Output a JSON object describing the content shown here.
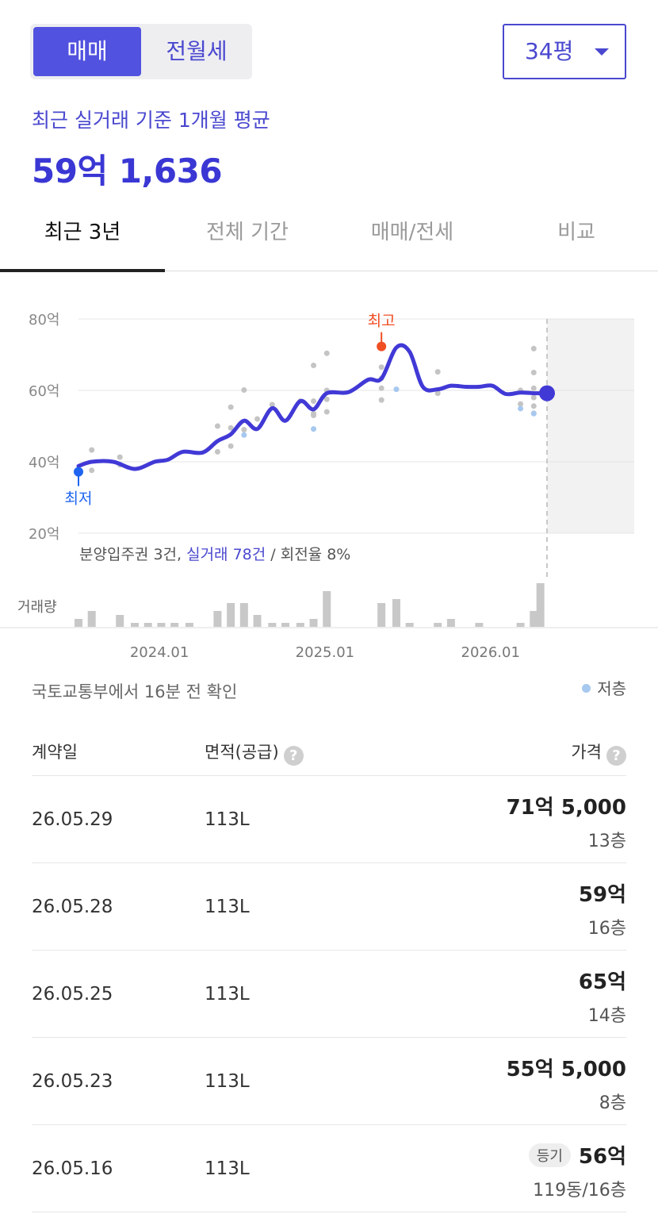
{
  "trade_tabs": {
    "sale": "매매",
    "rent": "전월세"
  },
  "size_selector": {
    "value": "34평"
  },
  "summary": {
    "caption": "최근 실거래 기준 1개월 평균",
    "value": "59억 1,636"
  },
  "period_tabs": [
    "최근 3년",
    "전체 기간",
    "매매/전세",
    "비교"
  ],
  "chart_data": {
    "type": "line",
    "y_axis": {
      "ticks": [
        "80억",
        "60억",
        "40억",
        "20억"
      ],
      "unit": "억",
      "range": [
        20,
        80
      ]
    },
    "x_axis": {
      "ticks": [
        "2024.01",
        "2025.01",
        "2026.01"
      ]
    },
    "volume_label": "거래량",
    "markers": {
      "high": "최고",
      "low": "최저"
    },
    "stats": {
      "presale": "분양입주권 3건, ",
      "actual": "실거래 78건",
      "turnover": " / 회전율 8%"
    },
    "series": [
      {
        "x": [
          2023.54,
          2023.62,
          2023.75,
          2023.88,
          2024.0,
          2024.08,
          2024.17,
          2024.29,
          2024.38,
          2024.46,
          2024.54,
          2024.62,
          2024.71,
          2024.79,
          2024.88,
          2024.96,
          2025.04,
          2025.17,
          2025.29,
          2025.37,
          2025.46,
          2025.54,
          2025.62,
          2025.71,
          2025.79,
          2025.88,
          2025.96,
          2026.04,
          2026.12,
          2026.21,
          2026.29,
          2026.37
        ],
        "y": [
          38.8,
          40,
          40,
          38,
          40,
          40.6,
          42.8,
          42.6,
          45.8,
          47.7,
          51.5,
          49.2,
          55,
          51.5,
          57,
          54.7,
          59.2,
          59.5,
          63,
          63.3,
          72,
          70.8,
          61,
          60.3,
          61.3,
          61,
          61,
          61.3,
          59,
          59.4,
          59.2,
          59.2
        ]
      }
    ],
    "transactions": [
      [
        2023.62,
        43.3
      ],
      [
        2023.62,
        37.6
      ],
      [
        2023.79,
        41.3
      ],
      [
        2023.79,
        39.2
      ],
      [
        2024.38,
        50
      ],
      [
        2024.38,
        42.8
      ],
      [
        2024.46,
        55.3
      ],
      [
        2024.46,
        49.5
      ],
      [
        2024.46,
        44.4
      ],
      [
        2024.54,
        60.1
      ],
      [
        2024.54,
        49
      ],
      [
        2024.62,
        52
      ],
      [
        2024.71,
        56
      ],
      [
        2024.88,
        57
      ],
      [
        2024.96,
        67
      ],
      [
        2024.96,
        57
      ],
      [
        2024.96,
        53.5
      ],
      [
        2024.96,
        53
      ],
      [
        2025.04,
        70.4
      ],
      [
        2025.04,
        57.5
      ],
      [
        2025.04,
        54
      ],
      [
        2025.04,
        60
      ],
      [
        2025.37,
        66.5
      ],
      [
        2025.37,
        63.4
      ],
      [
        2025.37,
        60.6
      ],
      [
        2025.37,
        57.3
      ],
      [
        2025.71,
        65.2
      ],
      [
        2025.71,
        59.2
      ],
      [
        2026.21,
        60
      ],
      [
        2026.21,
        56.2
      ],
      [
        2026.29,
        71.7
      ],
      [
        2026.29,
        65
      ],
      [
        2026.29,
        60.6
      ],
      [
        2026.29,
        58
      ],
      [
        2026.29,
        55.6
      ],
      [
        2026.29,
        53.6
      ]
    ],
    "low_floor_transactions": [
      [
        2024.54,
        47.5
      ],
      [
        2024.96,
        49.2
      ],
      [
        2025.46,
        60.3
      ],
      [
        2026.21,
        54.9
      ],
      [
        2026.29,
        53.5
      ]
    ],
    "high_point": [
      2025.37,
      72.3
    ],
    "low_point": [
      2023.54,
      37.2
    ],
    "last_point": [
      2026.37,
      59.2
    ],
    "forecast_region_start": 2026.37,
    "volume": {
      "x": [
        2023.54,
        2023.62,
        2023.79,
        2023.88,
        2023.96,
        2024.04,
        2024.12,
        2024.21,
        2024.38,
        2024.46,
        2024.54,
        2024.62,
        2024.71,
        2024.79,
        2024.88,
        2024.96,
        2025.04,
        2025.37,
        2025.46,
        2025.54,
        2025.71,
        2025.79,
        2025.96,
        2026.21,
        2026.29
      ],
      "y": [
        2,
        4,
        3,
        1,
        1,
        1,
        1,
        1,
        4,
        6,
        6,
        3,
        1,
        1,
        1,
        2,
        9,
        6,
        7,
        1,
        1,
        2,
        1,
        1,
        4,
        11
      ]
    }
  },
  "source_note": "국토교통부에서 16분 전 확인",
  "legend": {
    "low_floor": "저층"
  },
  "table": {
    "headers": {
      "date": "계약일",
      "area": "면적(공급)",
      "price": "가격"
    },
    "rows": [
      {
        "date": "26.05.29",
        "area": "113L",
        "price": "71억 5,000",
        "floor": "13층",
        "badge": ""
      },
      {
        "date": "26.05.28",
        "area": "113L",
        "price": "59억",
        "floor": "16층",
        "badge": ""
      },
      {
        "date": "26.05.25",
        "area": "113L",
        "price": "65억",
        "floor": "14층",
        "badge": ""
      },
      {
        "date": "26.05.23",
        "area": "113L",
        "price": "55억 5,000",
        "floor": "8층",
        "badge": ""
      },
      {
        "date": "26.05.16",
        "area": "113L",
        "price": "56억",
        "floor": "119동/16층",
        "badge": "등기"
      }
    ]
  }
}
